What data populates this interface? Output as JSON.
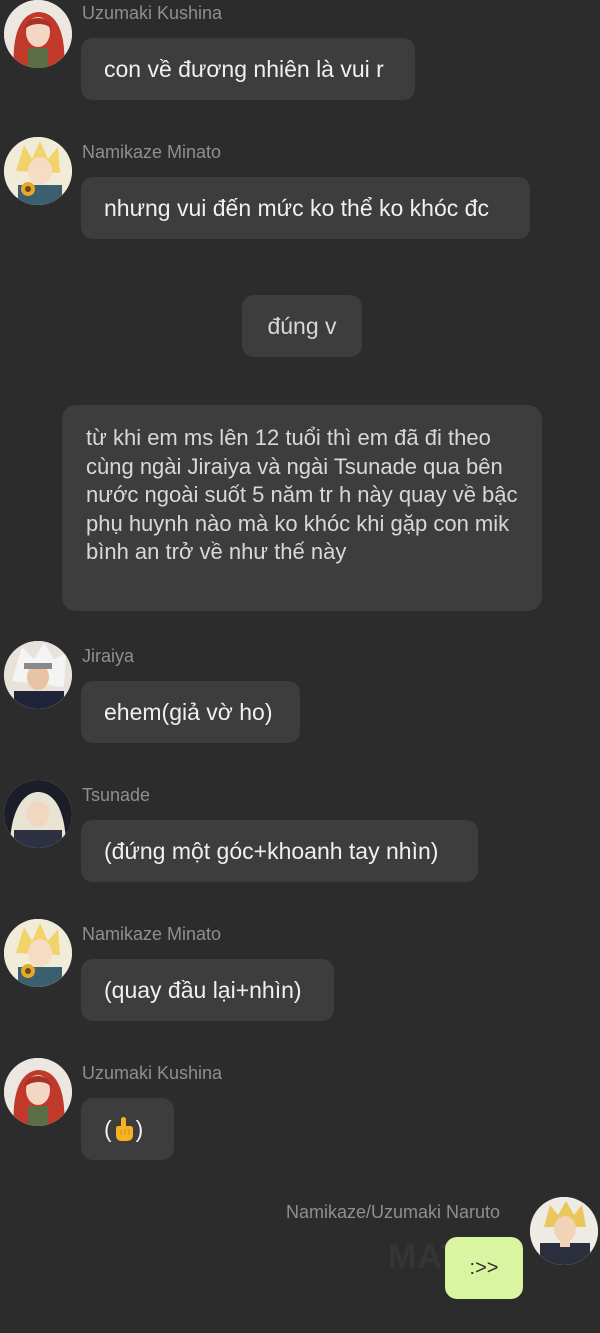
{
  "messages": [
    {
      "sender": "Uzumaki Kushina",
      "text": "con về đương nhiên là vui r"
    },
    {
      "sender": "Namikaze Minato",
      "text": "nhưng vui đến mức ko thể ko khóc đc"
    },
    {
      "sender": "",
      "text": "đúng v"
    },
    {
      "sender": "",
      "text": "từ khi em ms lên 12 tuổi thì em đã đi theo cùng ngài Jiraiya và ngài Tsunade qua bên nước ngoài suốt 5 năm tr h này quay về bậc phụ huynh nào mà ko khóc khi gặp con mik bình an trở về như thế này"
    },
    {
      "sender": "Jiraiya",
      "text": "ehem(giả vờ ho)"
    },
    {
      "sender": "Tsunade",
      "text": "(đứng một góc+khoanh tay nhìn)"
    },
    {
      "sender": "Namikaze Minato",
      "text": "(quay đầu lại+nhìn)"
    },
    {
      "sender": "Uzumaki Kushina",
      "text_open": "(",
      "emoji": "pointing-up-hand-icon",
      "text_close": ")"
    },
    {
      "sender": "Namikaze/Uzumaki Naruto",
      "text": ":>>"
    }
  ],
  "watermark": "MAT",
  "colors": {
    "background": "#2c2c2c",
    "bubble": "#3d3d3d",
    "mine_bubble": "#d9f5a2",
    "name_text": "#8f8f8f"
  }
}
